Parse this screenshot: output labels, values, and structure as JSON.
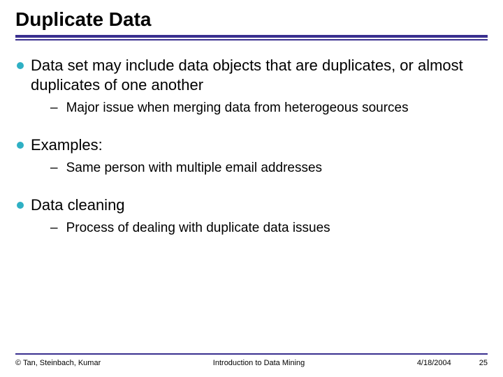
{
  "title": "Duplicate Data",
  "bullets": [
    {
      "text": "Data set may include data objects that are duplicates, or almost duplicates of one another",
      "sub": "Major issue when merging data from heterogeous sources"
    },
    {
      "text": "Examples:",
      "sub": "Same person with multiple email addresses"
    },
    {
      "text": "Data cleaning",
      "sub": "Process of dealing with duplicate data issues"
    }
  ],
  "footer": {
    "copyright": "© Tan, Steinbach, Kumar",
    "course": "Introduction to Data Mining",
    "date": "4/18/2004",
    "page": "25"
  }
}
